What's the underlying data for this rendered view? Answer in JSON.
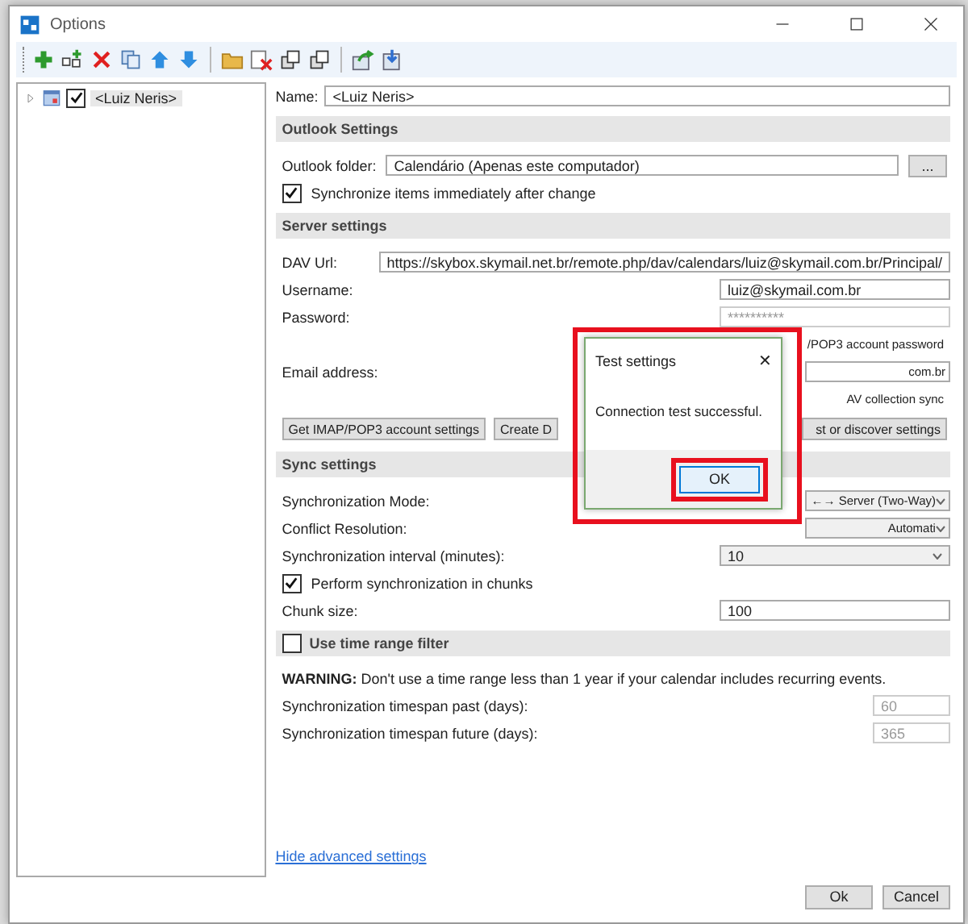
{
  "window": {
    "title": "Options"
  },
  "tree": {
    "items": [
      {
        "label": "<Luiz Neris>",
        "checked": true,
        "selected": true,
        "expanded": false
      }
    ]
  },
  "name_field": {
    "label": "Name:",
    "value": "<Luiz Neris>"
  },
  "sections": [
    {
      "title": "Outlook Settings",
      "rows": [
        {
          "kind": "folder",
          "label": "Outlook folder:",
          "value": "Calendário (Apenas este computador)",
          "button": "..."
        },
        {
          "kind": "checkbox",
          "label": "Synchronize items immediately after change",
          "checked": true
        }
      ]
    },
    {
      "title": "Server settings",
      "rows": [
        {
          "kind": "wide_field",
          "label": "DAV Url:",
          "value": "https://skybox.skymail.net.br/remote.php/dav/calendars/luiz@skymail.com.br/Principal/"
        },
        {
          "kind": "field",
          "label": "Username:",
          "value": "luiz@skymail.com.br",
          "disabled": false
        },
        {
          "kind": "field",
          "label": "Password:",
          "value": "**********",
          "disabled": true
        },
        {
          "kind": "note",
          "text": "/POP3 account password",
          "obscured": true
        },
        {
          "kind": "field",
          "label": "Email address:",
          "value": "com.br",
          "disabled": false,
          "obscured": true
        },
        {
          "kind": "note",
          "text": "AV collection sync",
          "obscured": true
        },
        {
          "kind": "buttons",
          "buttons": [
            {
              "label": "Get IMAP/POP3 account settings",
              "obscured": false
            },
            {
              "label": "Create D",
              "obscured": false
            },
            {
              "label": "st or discover settings",
              "obscured": true
            }
          ]
        }
      ]
    },
    {
      "title": "Sync settings",
      "rows": [
        {
          "kind": "dropdown",
          "label": "Synchronization Mode:",
          "value": "←→ Server (Two-Way)",
          "obscured": true
        },
        {
          "kind": "dropdown",
          "label": "Conflict Resolution:",
          "value": "Automati",
          "obscured": true
        },
        {
          "kind": "dropdown",
          "label": "Synchronization interval (minutes):",
          "value": "10"
        },
        {
          "kind": "checkbox",
          "label": "Perform synchronization in chunks",
          "checked": true
        },
        {
          "kind": "field",
          "label": "Chunk size:",
          "value": "100",
          "disabled": false
        }
      ]
    },
    {
      "title": "Use time range filter",
      "checked": false,
      "rows": [
        {
          "kind": "warning",
          "text": "**WARNING:** Don't use a time range less than 1 year if your calendar includes recurring events."
        },
        {
          "kind": "small_field",
          "label": "Synchronization timespan past (days):",
          "value": "60",
          "disabled": true
        },
        {
          "kind": "small_field",
          "label": "Synchronization timespan future (days):",
          "value": "365",
          "disabled": true
        }
      ]
    }
  ],
  "link": "Hide advanced settings",
  "buttons": [
    "Ok",
    "Cancel"
  ],
  "dialog": {
    "title": "Test settings",
    "close": "✕",
    "message": "Connection test successful.",
    "button": "OK",
    "highlighted": true
  }
}
